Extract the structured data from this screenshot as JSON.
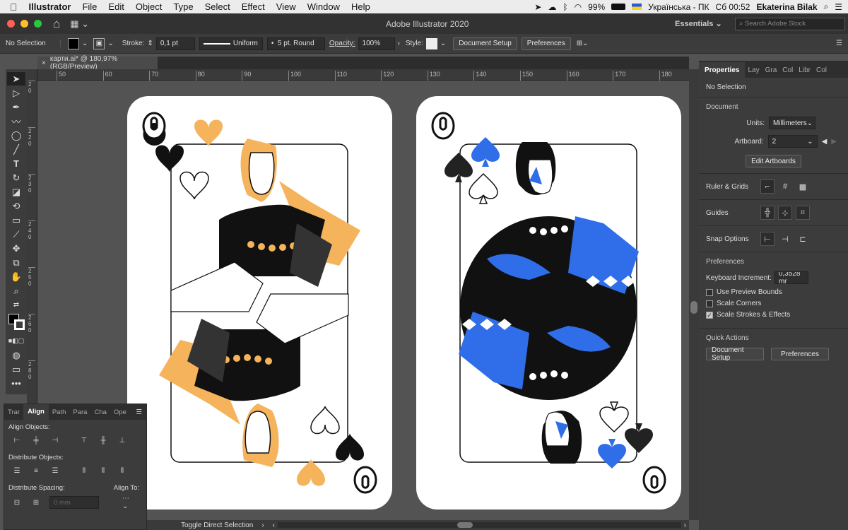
{
  "menu": {
    "app": "Illustrator",
    "items": [
      "File",
      "Edit",
      "Object",
      "Type",
      "Select",
      "Effect",
      "View",
      "Window",
      "Help"
    ],
    "battery": "99%",
    "lang": "Українська - ПК",
    "clock": "Сб 00:52",
    "user": "Ekaterina Bilak"
  },
  "titlebar": {
    "title": "Adobe Illustrator 2020",
    "workspace": "Essentials",
    "search_placeholder": "Search Adobe Stock"
  },
  "control": {
    "selection": "No Selection",
    "stroke_label": "Stroke:",
    "stroke_value": "0,1 pt",
    "profile": "Uniform",
    "brush": "5 pt. Round",
    "opacity_label": "Opacity:",
    "opacity_value": "100%",
    "style_label": "Style:",
    "doc_setup": "Document Setup",
    "preferences": "Preferences"
  },
  "document": {
    "tab_title": "карти.ai* @ 180,97% (RGB/Preview)",
    "status": "Toggle Direct Selection"
  },
  "ruler": {
    "h": [
      "50",
      "60",
      "70",
      "80",
      "90",
      "100",
      "110",
      "120",
      "130",
      "140",
      "150",
      "160",
      "170",
      "180"
    ],
    "v": [
      "2 0",
      "2 2 0",
      "2 3 0",
      "2 4 0",
      "2 5 0",
      "2 6 0",
      "2 8 0"
    ]
  },
  "properties": {
    "tabs": [
      "Properties",
      "Lay",
      "Gra",
      "Col",
      "Libr",
      "Col"
    ],
    "no_selection": "No Selection",
    "document_label": "Document",
    "units_label": "Units:",
    "units_value": "Millimeters",
    "artboard_label": "Artboard:",
    "artboard_value": "2",
    "edit_artboards": "Edit Artboards",
    "ruler_grids": "Ruler & Grids",
    "guides": "Guides",
    "snap": "Snap Options",
    "preferences_hd": "Preferences",
    "kbd_label": "Keyboard Increment:",
    "kbd_value": "0,3528 mr",
    "use_preview": "Use Preview Bounds",
    "scale_corners": "Scale Corners",
    "scale_strokes": "Scale Strokes & Effects",
    "quick_actions": "Quick Actions",
    "qa_doc_setup": "Document Setup",
    "qa_prefs": "Preferences"
  },
  "align": {
    "tabs": [
      "Trar",
      "Align",
      "Path",
      "Para",
      "Cha",
      "Ope"
    ],
    "align_objects": "Align Objects:",
    "distribute_objects": "Distribute Objects:",
    "distribute_spacing": "Distribute Spacing:",
    "align_to": "Align To:",
    "spacing_value": "0 mm"
  },
  "cards": [
    {
      "rank": "Q",
      "suit": "heart",
      "accent": "#f5b35c"
    },
    {
      "rank": "Q",
      "suit": "spade",
      "accent": "#2f6ee8"
    }
  ],
  "colors": {
    "menubar": "#ececec",
    "panel": "#3c3c3c",
    "canvas": "#535353",
    "accent_blue": "#2f6ee8",
    "accent_orange": "#f5b35c"
  }
}
